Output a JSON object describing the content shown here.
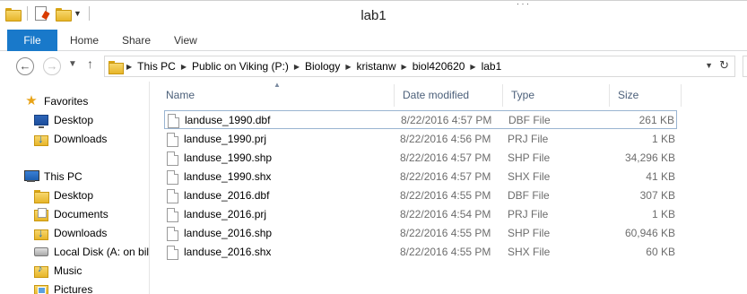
{
  "window": {
    "title": "lab1"
  },
  "ribbon": {
    "tabs": [
      "File",
      "Home",
      "Share",
      "View"
    ]
  },
  "address": {
    "crumbs": [
      "This PC",
      "Public on Viking (P:)",
      "Biology",
      "kristanw",
      "biol420620",
      "lab1"
    ]
  },
  "nav": {
    "items": [
      {
        "label": "Favorites",
        "icon": "star-icon"
      },
      {
        "label": "Desktop",
        "icon": "desktop-icon"
      },
      {
        "label": "Downloads",
        "icon": "downloads-folder-icon"
      },
      {
        "label": "This PC",
        "icon": "computer-icon"
      },
      {
        "label": "Desktop",
        "icon": "folder-icon"
      },
      {
        "label": "Documents",
        "icon": "documents-folder-icon"
      },
      {
        "label": "Downloads",
        "icon": "downloads-folder-icon"
      },
      {
        "label": "Local Disk (A: on bill",
        "icon": "disk-icon"
      },
      {
        "label": "Music",
        "icon": "music-folder-icon"
      },
      {
        "label": "Pictures",
        "icon": "pictures-folder-icon"
      }
    ]
  },
  "columns": {
    "name": "Name",
    "date": "Date modified",
    "type": "Type",
    "size": "Size"
  },
  "files": [
    {
      "name": "landuse_1990.dbf",
      "date": "8/22/2016 4:57 PM",
      "type": "DBF File",
      "size": "261 KB"
    },
    {
      "name": "landuse_1990.prj",
      "date": "8/22/2016 4:56 PM",
      "type": "PRJ File",
      "size": "1 KB"
    },
    {
      "name": "landuse_1990.shp",
      "date": "8/22/2016 4:57 PM",
      "type": "SHP File",
      "size": "34,296 KB"
    },
    {
      "name": "landuse_1990.shx",
      "date": "8/22/2016 4:57 PM",
      "type": "SHX File",
      "size": "41 KB"
    },
    {
      "name": "landuse_2016.dbf",
      "date": "8/22/2016 4:55 PM",
      "type": "DBF File",
      "size": "307 KB"
    },
    {
      "name": "landuse_2016.prj",
      "date": "8/22/2016 4:54 PM",
      "type": "PRJ File",
      "size": "1 KB"
    },
    {
      "name": "landuse_2016.shp",
      "date": "8/22/2016 4:55 PM",
      "type": "SHP File",
      "size": "60,946 KB"
    },
    {
      "name": "landuse_2016.shx",
      "date": "8/22/2016 4:55 PM",
      "type": "SHX File",
      "size": "60 KB"
    }
  ],
  "colors": {
    "accent": "#1979ca",
    "header_text": "#4c607a",
    "secondary_text": "#6d6d6d"
  }
}
